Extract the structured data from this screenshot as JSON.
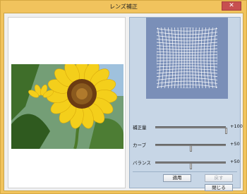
{
  "window": {
    "title": "レンズ補正",
    "close_glyph": "✕"
  },
  "sliders": [
    {
      "label": "補正量",
      "value": "+100",
      "level": 1.0
    },
    {
      "label": "カーブ",
      "value": "+50",
      "level": 0.5
    },
    {
      "label": "バランス",
      "value": "+50",
      "level": 0.5
    }
  ],
  "buttons": {
    "apply": "適用",
    "undo": "戻す",
    "close": "閉じる"
  },
  "icons": {
    "distortion_grid": "distortion-grid-icon"
  },
  "colors": {
    "title_bar": "#f1c35d",
    "close_button": "#c75050",
    "panel_bg": "#c7d6e6",
    "grid_bg": "#7a8fb8"
  }
}
